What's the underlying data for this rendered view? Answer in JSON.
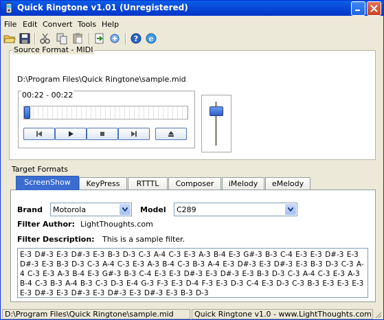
{
  "window": {
    "title": "Quick Ringtone v1.01 (Unregistered)"
  },
  "menu": [
    "File",
    "Edit",
    "Convert",
    "Tools",
    "Help"
  ],
  "toolbar": {
    "icons": [
      "open-folder",
      "save",
      "cut",
      "copy",
      "paste",
      "convert",
      "transfer",
      "help",
      "web"
    ]
  },
  "source": {
    "legend": "Source Format - MIDI",
    "file_path": "D:\\Program Files\\Quick Ringtone\\sample.mid",
    "time_range": "00:22 - 00:22"
  },
  "target": {
    "label": "Target Formats",
    "tabs": [
      "ScreenShow",
      "KeyPress",
      "RTTTL",
      "Composer",
      "iMelody",
      "eMelody"
    ],
    "active_tab": "ScreenShow",
    "brand_label": "Brand",
    "brand_value": "Motorola",
    "model_label": "Model",
    "model_value": "C289",
    "author_label": "Filter Author:",
    "author_value": "LightThoughts.com",
    "description_label": "Filter Description:",
    "description_value": "This is a sample filter.",
    "notes_text": "E-3 D#-3 E-3 D#-3 E-3 B-3 D-3 C-3 A-4 C-3 E-3 A-3 B-4 E-3 G#-3 B-3 C-4 E-3 E-3 D#-3 E-3 D#-3 E-3 B-3 D-3 C-3 A-4 C-3 E-3 A-3 B-4 C-3 B-3 A-4 E-3 D#-3 E-3 D#-3 E-3 B-3 D-3 C-3 A-4 C-3 E-3 A-3 B-4 E-3 G#-3 B-3 C-4 E-3 E-3 D#-3 E-3 D#-3 E-3 B-3 D-3 C-3 A-4 C-3 E-3 A-3 B-4 C-3 B-3 A-4 B-3 C-3 D-3 E-4 G-3 F-3 E-3 D-4 F-3 E-3 D-3 C-4 E-3 D-3 C-3 B-3 E-3 E-3 E-3 E-3 D#-3 E-3 D#-3 E-3 D#-3 E-3 D#-3 E-3 B-3 D-3"
  },
  "status": {
    "left": "D:\\Program Files\\Quick Ringtone\\sample.mid",
    "right": "Quick Ringtone v1.0 - www.LightThoughts.com"
  },
  "colors": {
    "titlebar": "#0a49d8",
    "active_tab": "#3a6cd1",
    "frame": "#ece9d8"
  }
}
